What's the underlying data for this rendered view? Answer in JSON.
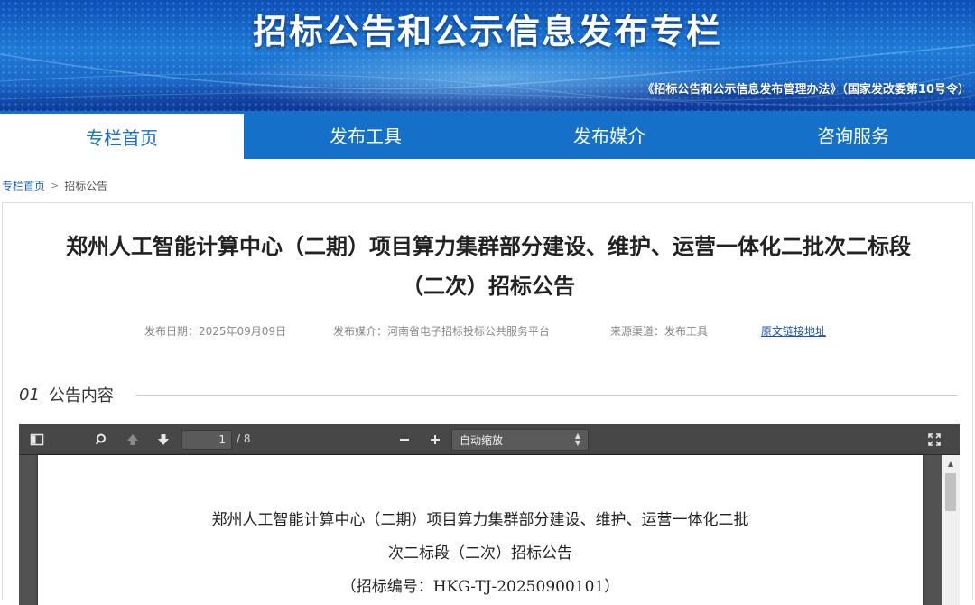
{
  "banner": {
    "title": "招标公告和公示信息发布专栏",
    "subtitle": "《招标公告和公示信息发布管理办法》（国家发改委第10号令）"
  },
  "nav": {
    "items": [
      {
        "label": "专栏首页",
        "active": true
      },
      {
        "label": "发布工具",
        "active": false
      },
      {
        "label": "发布媒介",
        "active": false
      },
      {
        "label": "咨询服务",
        "active": false
      }
    ]
  },
  "breadcrumb": {
    "home": "专栏首页",
    "separator": ">",
    "current": "招标公告"
  },
  "article": {
    "title_line1": "郑州人工智能计算中心（二期）项目算力集群部分建设、维护、运营一体化二批次二标段",
    "title_line2": "（二次）招标公告",
    "publish_date": "发布日期：2025年09月09日",
    "media": "发布媒介：河南省电子招标投标公共服务平台",
    "source": "来源渠道：发布工具",
    "original_link": "原文链接地址"
  },
  "section": {
    "number": "01",
    "label": "公告内容"
  },
  "pdf_viewer": {
    "current_page": "1",
    "total_pages": "/ 8",
    "zoom": "自动缩放",
    "icons": [
      "sidebar-toggle-icon",
      "search-icon",
      "previous-page-icon",
      "next-page-icon",
      "zoom-out-icon",
      "zoom-in-icon",
      "presentation-mode-icon"
    ],
    "page_content": {
      "line1": "郑州人工智能计算中心（二期）项目算力集群部分建设、维护、运营一体化二批",
      "line2": "次二标段（二次）招标公告",
      "line3": "（招标编号：HKG-TJ-20250900101）"
    }
  },
  "colors": {
    "nav_bg": "#1470c8",
    "link": "#1a4fb0",
    "banner_top": "#0d4fb8"
  }
}
